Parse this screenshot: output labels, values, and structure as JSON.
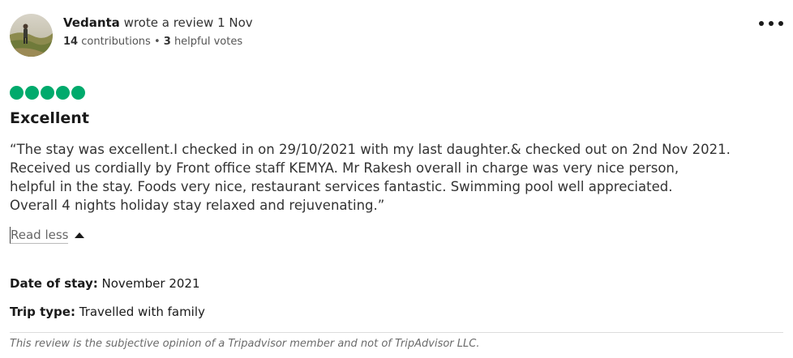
{
  "review": {
    "author": {
      "name": "Vedanta",
      "action": "wrote a review",
      "date": "1 Nov",
      "contributions_count": "14",
      "contributions_label": "contributions",
      "separator": "•",
      "helpful_count": "3",
      "helpful_label": "helpful votes",
      "avatar_icon": "avatar-photo"
    },
    "more_icon": "more-options-icon",
    "rating": {
      "value": 5,
      "max": 5,
      "color": "#00aa6c"
    },
    "title": "Excellent",
    "body_lines": [
      "“The stay was excellent.I checked in on 29/10/2021 with my last daughter.& checked out on 2nd Nov 2021.",
      "Received us cordially by Front office staff KEMYA. Mr Rakesh overall in charge was very nice person,",
      "helpful in the stay. Foods very nice, restaurant services fantastic. Swimming pool well appreciated.",
      "Overall 4 nights holiday stay relaxed and rejuvenating.”"
    ],
    "read_less_label": "Read less",
    "date_of_stay": {
      "label": "Date of stay:",
      "value": "November 2021"
    },
    "trip_type": {
      "label": "Trip type:",
      "value": "Travelled with family"
    },
    "disclaimer": "This review is the subjective opinion of a Tripadvisor member and not of TripAdvisor LLC."
  }
}
